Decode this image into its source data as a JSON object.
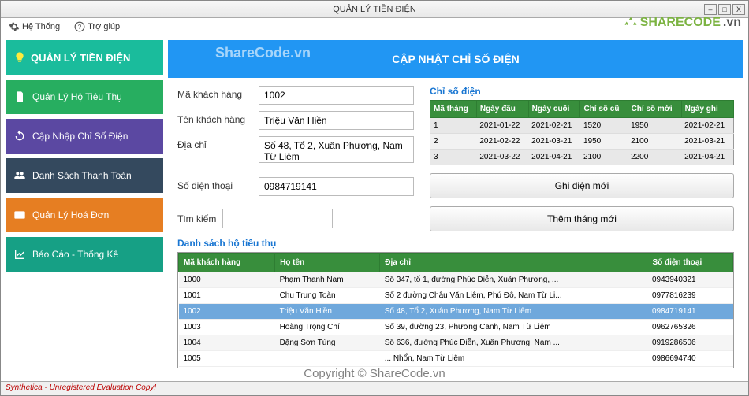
{
  "window_title": "QUẢN LÝ TIỀN ĐIỆN",
  "menubar": {
    "system": "Hệ Thống",
    "help": "Trợ giúp"
  },
  "sidebar": {
    "title": "QUẢN LÝ TIỀN ĐIỆN",
    "items": [
      "Quản Lý Hộ Tiêu Thụ",
      "Cập Nhập Chỉ Số Điện",
      "Danh Sách Thanh Toán",
      "Quản Lý Hoá Đơn",
      "Báo Cáo - Thống Kê"
    ]
  },
  "main": {
    "header": "CẬP NHẬT CHỈ SỐ ĐIỆN",
    "watermark": "ShareCode.vn",
    "form": {
      "code_label": "Mã khách hàng",
      "code_value": "1002",
      "name_label": "Tên khách hàng",
      "name_value": "Triệu Văn Hiền",
      "addr_label": "Địa chỉ",
      "addr_value": "Số 48, Tổ 2, Xuân Phương, Nam Từ Liêm",
      "phone_label": "Số điện thoại",
      "phone_value": "0984719141"
    },
    "index_section": {
      "label": "Chỉ số điện",
      "headers": [
        "Mã tháng",
        "Ngày đầu",
        "Ngày cuối",
        "Chỉ số cũ",
        "Chỉ số mới",
        "Ngày ghi"
      ],
      "rows": [
        [
          "1",
          "2021-01-22",
          "2021-02-21",
          "1520",
          "1950",
          "2021-02-21"
        ],
        [
          "2",
          "2021-02-22",
          "2021-03-21",
          "1950",
          "2100",
          "2021-03-21"
        ],
        [
          "3",
          "2021-03-22",
          "2021-04-21",
          "2100",
          "2200",
          "2021-04-21"
        ]
      ]
    },
    "buttons": {
      "record": "Ghi điện mới",
      "add_month": "Thêm tháng mới"
    },
    "search_label": "Tìm kiếm",
    "customer_list": {
      "label": "Danh sách hộ tiêu thụ",
      "headers": [
        "Mã khách hàng",
        "Họ tên",
        "Địa chỉ",
        "Số điện thoại"
      ],
      "rows": [
        {
          "id": "1000",
          "name": "Phạm Thanh Nam",
          "addr": "Số 347, tổ 1, đường Phúc Diễn, Xuân Phương, ...",
          "phone": "0943940321"
        },
        {
          "id": "1001",
          "name": "Chu Trung Toàn",
          "addr": "Số 2 đường Châu Văn Liêm, Phú Đô, Nam Từ Li...",
          "phone": "0977816239"
        },
        {
          "id": "1002",
          "name": "Triệu Văn Hiền",
          "addr": "Số 48, Tổ 2, Xuân Phương, Nam Từ Liêm",
          "phone": "0984719141",
          "selected": true
        },
        {
          "id": "1003",
          "name": "Hoàng Trọng Chí",
          "addr": "Số 39, đường 23, Phương Canh, Nam Từ Liêm",
          "phone": "0962765326"
        },
        {
          "id": "1004",
          "name": "Đặng Sơn Tùng",
          "addr": "Số 636, đường Phúc Diễn, Xuân Phương, Nam ...",
          "phone": "0919286506"
        },
        {
          "id": "1005",
          "name": "",
          "addr": "... Nhổn, Nam Từ Liêm",
          "phone": "0986694740"
        }
      ]
    }
  },
  "statusbar": "Synthetica - Unregistered Evaluation Copy!",
  "overlays": {
    "logo": "SHARECODE",
    "logo_suffix": ".vn",
    "copyright": "Copyright © ShareCode.vn"
  }
}
